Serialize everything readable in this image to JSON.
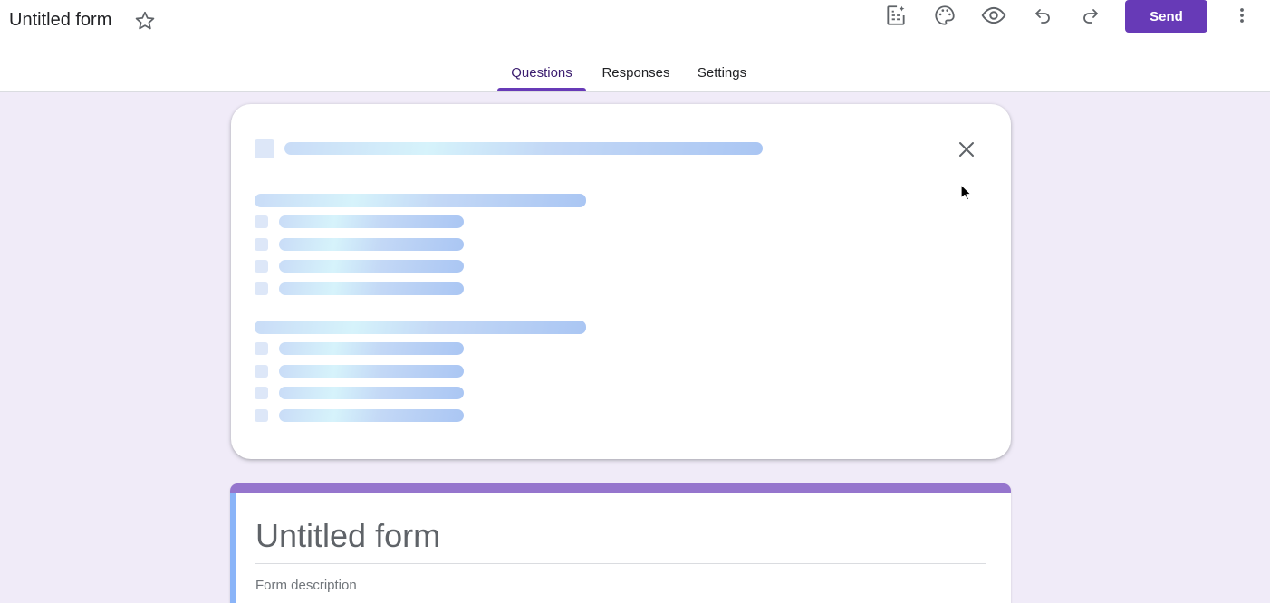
{
  "header": {
    "title": "Untitled form",
    "send_label": "Send",
    "icons": [
      "star-icon",
      "gemini-form-icon",
      "palette-icon",
      "preview-eye-icon",
      "undo-icon",
      "redo-icon",
      "more-vert-icon"
    ]
  },
  "tabs": [
    {
      "label": "Questions",
      "active": true
    },
    {
      "label": "Responses",
      "active": false
    },
    {
      "label": "Settings",
      "active": false
    }
  ],
  "loading_panel": {
    "icons": [
      "close-icon",
      "cursor-icon"
    ]
  },
  "form": {
    "title": "Untitled form",
    "description_placeholder": "Form description"
  },
  "colors": {
    "accent": "#673ab7",
    "form_top_bar": "#9575cd",
    "form_left_bar": "#8ab4f8",
    "background": "#f0ebf8"
  }
}
